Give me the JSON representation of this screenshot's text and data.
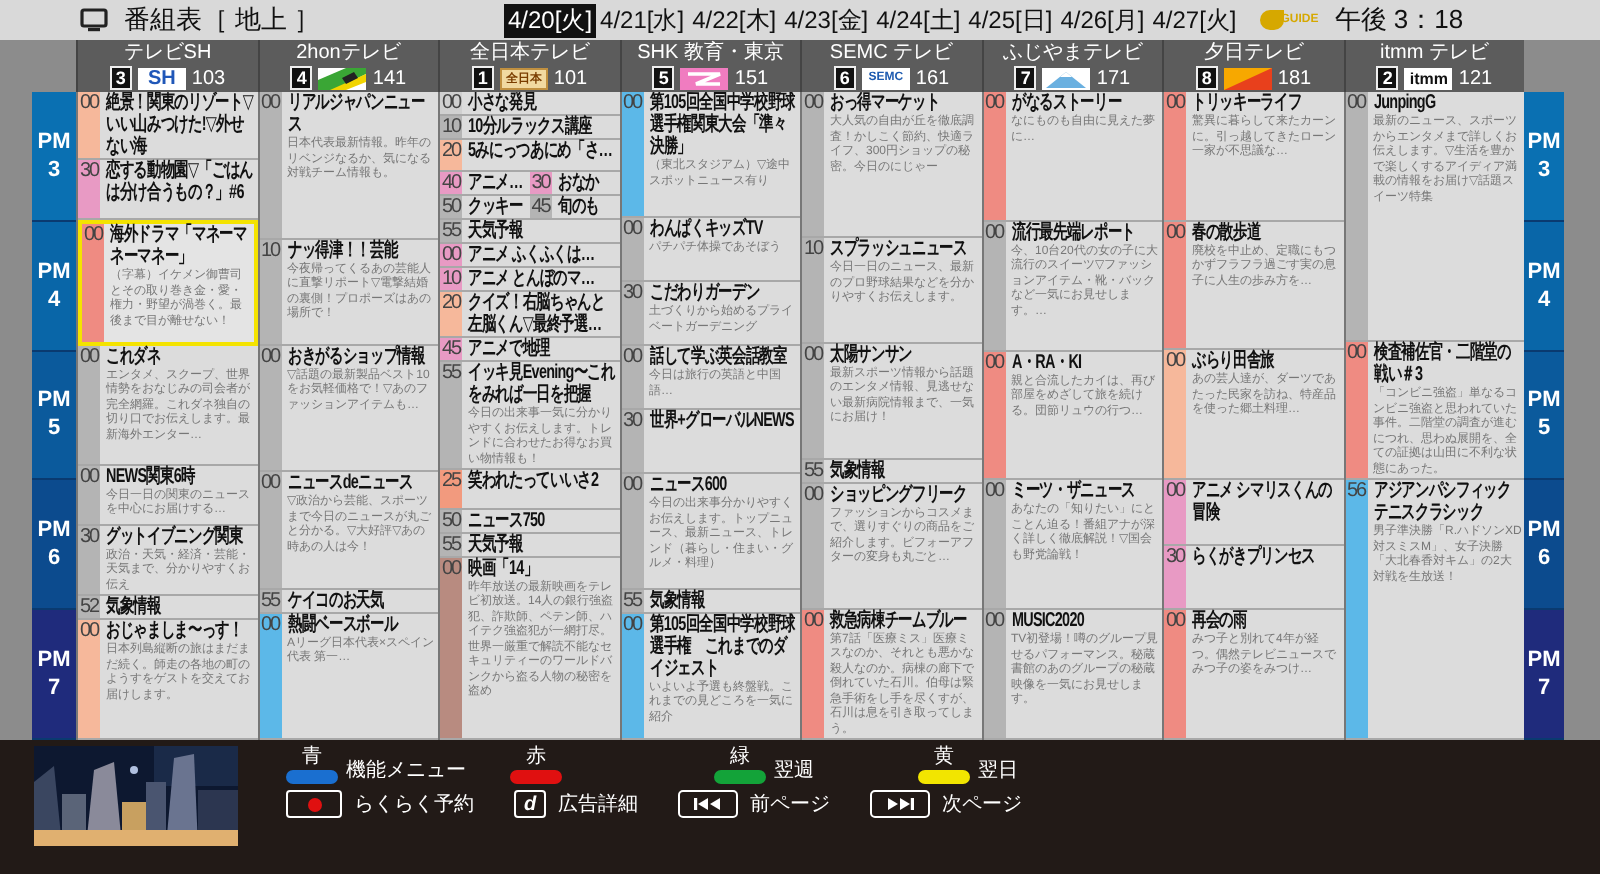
{
  "header": {
    "title": "番組表［ 地上 ］",
    "dates": [
      {
        "label": "4/20[火]",
        "selected": true
      },
      {
        "label": "4/21[水]",
        "selected": false
      },
      {
        "label": "4/22[木]",
        "selected": false
      },
      {
        "label": "4/23[金]",
        "selected": false
      },
      {
        "label": "4/24[土]",
        "selected": false
      },
      {
        "label": "4/25[日]",
        "selected": false
      },
      {
        "label": "4/26[月]",
        "selected": false
      },
      {
        "label": "4/27[火]",
        "selected": false
      }
    ],
    "logo_text": "GUIDE",
    "clock": "午後 3：18"
  },
  "time_left": [
    {
      "label": "PM",
      "hour": "3"
    },
    {
      "label": "PM",
      "hour": "4"
    },
    {
      "label": "PM",
      "hour": "5"
    },
    {
      "label": "PM",
      "hour": "6"
    },
    {
      "label": "PM",
      "hour": "7"
    }
  ],
  "time_right": [
    {
      "label": "PM",
      "hour": "3"
    },
    {
      "label": "PM",
      "hour": "4"
    },
    {
      "label": "PM",
      "hour": "5"
    },
    {
      "label": "PM",
      "hour": "6"
    },
    {
      "label": "PM",
      "hour": "7"
    }
  ],
  "channels": [
    {
      "name": "テレビSH",
      "button": "3",
      "logo": {
        "kind": "sh",
        "text": "SH"
      },
      "number": "103",
      "slots": [
        [
          {
            "kind": "program",
            "minute": "00",
            "title": "絶景！関東のリゾート▽いい山みつけた!▽外せない海",
            "color": "#f6b89b",
            "selected": false
          },
          {
            "kind": "program",
            "minute": "30",
            "title": "恋する動物園▽「ごはんは分け合うもの？」#6",
            "color": "#e89ac4",
            "selected": false
          }
        ],
        [
          {
            "kind": "program",
            "minute": "00",
            "title": "海外ドラマ「マネーマネーマネー」",
            "desc": "（字幕）イケメン御曹司とその取り巻き金・愛・権力・野望が渦巻く。最後まで目が離せない！",
            "color": "#ef8b82",
            "selected": true
          }
        ],
        [
          {
            "kind": "program",
            "minute": "00",
            "title": "これダネ",
            "desc": "エンタメ、スクープ、世界情勢をおなじみの司会者が完全網羅。これダネ独自の切り口でお伝えします。最新海外エンター…",
            "color": "#b4b4b4",
            "selected": false
          }
        ],
        [
          {
            "kind": "program",
            "minute": "00",
            "title": "NEWS関東6時",
            "desc": "今日一日の関東のニュースを中心にお届けする…",
            "color": "#b4b4b4",
            "selected": false
          },
          {
            "kind": "program",
            "minute": "30",
            "title": "グットイブニング関東",
            "desc": "政治・天気・経済・芸能・天気まで、分かりやすくお伝え",
            "color": "#b4b4b4",
            "selected": false
          },
          {
            "kind": "program",
            "minute": "52",
            "title": "気象情報",
            "color": "#b4b4b4",
            "selected": false
          }
        ],
        [
          {
            "kind": "program",
            "minute": "00",
            "title": "おじゃましま〜っす！",
            "desc": "日本列島縦断の旅はまだまだ続く。師走の各地の町のようすをゲストを交えてお届けします。",
            "color": "#f6b89b",
            "selected": false
          }
        ]
      ]
    },
    {
      "name": "2honテレビ",
      "button": "4",
      "logo": {
        "kind": "stripe"
      },
      "number": "141",
      "slots": [
        [
          {
            "kind": "program",
            "minute": "00",
            "title": "リアルジャパンニュース",
            "desc": "日本代表最新情報。昨年のリベンジなるか、気になる対戦チーム情報も。",
            "color": "#b4b4b4",
            "selected": false
          }
        ],
        [
          {
            "kind": "program",
            "minute": "10",
            "title": "ナッ得津！！芸能",
            "desc": "今夜帰ってくるあの芸能人に直撃リポート▽電撃結婚の裏側！プロポーズはあの場所で！",
            "color": "#b4b4b4",
            "selected": false
          }
        ],
        [
          {
            "kind": "program",
            "minute": "00",
            "title": "おきがるショップ情報",
            "desc": "▽話題の最新製品ベスト10をお気軽価格で！▽あのファッションアイテムも…",
            "color": "#b4b4b4",
            "selected": false
          }
        ],
        [
          {
            "kind": "program",
            "minute": "00",
            "title": "ニュースdeニュース",
            "desc": "▽政治から芸能、スポーツまで今日のニュースが丸ごと分かる。▽大好評▽あの時あの人は今！",
            "color": "#b4b4b4",
            "selected": false
          },
          {
            "kind": "program",
            "minute": "55",
            "title": "ケイコのお天気",
            "color": "#b4b4b4",
            "selected": false
          }
        ],
        [
          {
            "kind": "program",
            "minute": "00",
            "title": "熱闘ベースボール",
            "desc": "Aリーグ日本代表×スペイン代表 第一…",
            "color": "#5cb8e8",
            "selected": false
          }
        ]
      ]
    },
    {
      "name": "全日本テレビ",
      "button": "1",
      "logo": {
        "kind": "zennihon",
        "text": "全日本"
      },
      "number": "101",
      "slots": [
        [
          {
            "kind": "program",
            "minute": "00",
            "title": "小さな発見",
            "color": "#d0d0d0",
            "selected": false
          },
          {
            "kind": "program",
            "minute": "10",
            "title": "10分ルラックス講座",
            "color": "#b4b4b4",
            "selected": false
          },
          {
            "kind": "program",
            "minute": "20",
            "title": "5みにっつあにめ「さ…",
            "color": "#f6b89b",
            "selected": false
          },
          {
            "kind": "pair",
            "halves": [
              {
                "minute": "40",
                "title": "アニメ…",
                "color": "#e89ac4",
                "selected": false
              },
              {
                "minute": "30",
                "title": "おなか",
                "color": "#e89ac4",
                "selected": false
              }
            ]
          },
          {
            "kind": "pair",
            "halves": [
              {
                "minute": "50",
                "title": "クッキー",
                "color": "#b4b4b4",
                "selected": false
              },
              {
                "minute": "45",
                "title": "旬のも",
                "color": "#b4b4b4",
                "selected": false
              }
            ]
          },
          {
            "kind": "program",
            "minute": "55",
            "title": "天気予報",
            "color": "#b4b4b4",
            "selected": false
          }
        ],
        [
          {
            "kind": "program",
            "minute": "00",
            "title": "アニメ ふくふくは…",
            "color": "#e89ac4",
            "selected": false
          },
          {
            "kind": "program",
            "minute": "10",
            "title": "アニメ とんぼのマ…",
            "color": "#e89ac4",
            "selected": false
          },
          {
            "kind": "program",
            "minute": "20",
            "title": "クイズ！右脳ちゃんと左脳くん▽最終予選…",
            "color": "#f6b89b",
            "selected": false
          },
          {
            "kind": "program",
            "minute": "45",
            "title": "アニメで地理",
            "color": "#e89ac4",
            "selected": false
          },
          {
            "kind": "program",
            "minute": "55",
            "title": "イッキ見Evening〜これをみれば一日を把握",
            "desc": "今日の出来事一気に分かりやすくお伝えします。トレンドに合わせたお得なお買い物情報も！",
            "color": "#b4b4b4",
            "selected": false
          }
        ],
        [
          {
            "kind": "program",
            "minute": "25",
            "title": "笑われたっていいさ2",
            "color": "#f29a7e",
            "selected": false
          },
          {
            "kind": "program",
            "minute": "50",
            "title": "ニュース750",
            "color": "#b4b4b4",
            "selected": false
          },
          {
            "kind": "program",
            "minute": "55",
            "title": "天気予報",
            "color": "#b4b4b4",
            "selected": false
          }
        ],
        [
          {
            "kind": "program",
            "minute": "00",
            "title": "映画「14」",
            "desc": "昨年放送の最新映画をテレビ初放送。14人の銀行強盗犯、詐欺師、ペテン師、ハイテク強盗犯が一網打尽。世界一厳重で解読不能なセキュリティーのワールドバンクから盗る人物の秘密を盗め",
            "color": "#b88b80",
            "selected": false
          }
        ]
      ]
    },
    {
      "name": "SHK 教育・東京",
      "button": "5",
      "logo": {
        "kind": "shk"
      },
      "number": "151",
      "slots": [
        [
          {
            "kind": "program",
            "minute": "00",
            "title": "第105回全国中学校野球選手権関東大会「準々決勝」",
            "desc": "（東北スタジアム）▽途中スポットニュース有り",
            "color": "#5cb8e8",
            "selected": false
          }
        ],
        [
          {
            "kind": "program",
            "minute": "00",
            "title": "わんぱくキッズTV",
            "desc": "パチパチ体操であそぼう",
            "color": "#b4b4b4",
            "selected": false
          },
          {
            "kind": "program",
            "minute": "30",
            "title": "こだわりガーデン",
            "desc": "土づくりから始めるプライベートガーデニング",
            "color": "#b4b4b4",
            "selected": false
          }
        ],
        [
          {
            "kind": "program",
            "minute": "00",
            "title": "話して学ぶ英会話教室",
            "desc": "今日は旅行の英語と中国語…",
            "color": "#b4b4b4",
            "selected": false
          },
          {
            "kind": "program",
            "minute": "30",
            "title": "世界+グローバルNEWS",
            "color": "#b4b4b4",
            "selected": false
          }
        ],
        [
          {
            "kind": "program",
            "minute": "00",
            "title": "ニュース600",
            "desc": "今日の出来事分かりやすくお伝えします。トップニュース、最新ニュース、トレンド（暮らし・住まい・グルメ・料理）",
            "color": "#b4b4b4",
            "selected": false
          },
          {
            "kind": "program",
            "minute": "55",
            "title": "気象情報",
            "color": "#b4b4b4",
            "selected": false
          }
        ],
        [
          {
            "kind": "program",
            "minute": "00",
            "title": "第105回全国中学校野球選手権　これまでのダイジェスト",
            "desc": "いよいよ予選も終盤戦。これまでの見どころを一気に紹介",
            "color": "#5cb8e8",
            "selected": false
          }
        ]
      ]
    },
    {
      "name": "SEMC テレビ",
      "button": "6",
      "logo": {
        "kind": "semc",
        "text": "SEMC"
      },
      "number": "161",
      "slots": [
        [
          {
            "kind": "program",
            "minute": "00",
            "title": "おっ得マーケット",
            "desc": "大人気の自由が丘を徹底調査！かしこく節約、快適ライフ、300円ショップの秘密。今日のにじゃー",
            "color": "#b4b4b4",
            "selected": false
          }
        ],
        [
          {
            "kind": "program",
            "minute": "10",
            "title": "スプラッシュニュース",
            "desc": "今日一日のニュース、最新のプロ野球結果などを分かりやすくお伝えします。",
            "color": "#b4b4b4",
            "selected": false
          }
        ],
        [
          {
            "kind": "program",
            "minute": "00",
            "title": "太陽サンサン",
            "desc": "最新スポーツ情報から話題のエンタメ情報、見逃せない最新病院情報まで、一気にお届け！",
            "color": "#b4b4b4",
            "selected": false
          },
          {
            "kind": "program",
            "minute": "55",
            "title": "気象情報",
            "color": "#b4b4b4",
            "selected": false
          }
        ],
        [
          {
            "kind": "program",
            "minute": "00",
            "title": "ショッピングフリーク",
            "desc": "ファッションからコスメまで、選りすぐりの商品をご紹介します。ビフォーアフターの変身も丸ごと…",
            "color": "#b4b4b4",
            "selected": false
          }
        ],
        [
          {
            "kind": "program",
            "minute": "00",
            "title": "救急病棟チームブルー",
            "desc": "第7話「医療ミス」医療ミスなのか、それとも悪かな殺人なのか。病棟の廊下で倒れていた石川。伯母は緊急手術をし手を尽くすが、石川は息を引き取ってしまう。",
            "color": "#ef8b82",
            "selected": false
          }
        ]
      ]
    },
    {
      "name": "ふじやまテレビ",
      "button": "7",
      "logo": {
        "kind": "mountain"
      },
      "number": "171",
      "slots": [
        [
          {
            "kind": "program",
            "minute": "00",
            "title": "がなるストーリー",
            "desc": "なにものも自由に見えた夢に…",
            "color": "#ef8b82",
            "selected": false
          }
        ],
        [
          {
            "kind": "program",
            "minute": "00",
            "title": "流行最先端レポート",
            "desc": "今、10台20代の女の子に大流行のスイーツ▽ファッションアイテム・靴・バックなど一気にお見せします。…",
            "color": "#b4b4b4",
            "selected": false
          }
        ],
        [
          {
            "kind": "program",
            "minute": "00",
            "title": "A・RA・KI",
            "desc": "親と合流したカイは、再び部屋をめざして旅を続ける。団節リュウの行つ…",
            "color": "#ef8b82",
            "selected": false
          }
        ],
        [
          {
            "kind": "program",
            "minute": "00",
            "title": "ミーツ・ザニュース",
            "desc": "あなたの「知りたい」にとことん迫る！番組アナが深く詳しく徹底解説！▽国会も野党論戦！",
            "color": "#b4b4b4",
            "selected": false
          }
        ],
        [
          {
            "kind": "program",
            "minute": "00",
            "title": "MUSIC2020",
            "desc": "TV初登場！噂のグループ見せるパフォーマンス。秘蔵書館のあのグループの秘蔵映像を一気にお見せします。",
            "color": "#b4b4b4",
            "selected": false
          }
        ]
      ]
    },
    {
      "name": "夕日テレビ",
      "button": "8",
      "logo": {
        "kind": "sunset"
      },
      "number": "181",
      "slots": [
        [
          {
            "kind": "program",
            "minute": "00",
            "title": "トリッキーライフ",
            "desc": "驚異に暮らして来たカーンに。引っ越してきたローン一家が不思議な…",
            "color": "#ef8b82",
            "selected": false
          }
        ],
        [
          {
            "kind": "program",
            "minute": "00",
            "title": "春の散歩道",
            "desc": "廃校を中止め、定職にもつかずフラフラ過ごす実の息子に人生の歩み方を…",
            "color": "#ef8b82",
            "selected": false
          }
        ],
        [
          {
            "kind": "program",
            "minute": "00",
            "title": "ぶらり田舎旅",
            "desc": "あの芸人達が、ダーツであたった民家を訪ね、特産品を使った郷土料理…",
            "color": "#f6b89b",
            "selected": false
          }
        ],
        [
          {
            "kind": "program",
            "minute": "00",
            "title": "アニメ シマリスくんの冒険",
            "color": "#e89ac4",
            "selected": false
          },
          {
            "kind": "program",
            "minute": "30",
            "title": "らくがきプリンセス",
            "color": "#e89ac4",
            "selected": false
          }
        ],
        [
          {
            "kind": "program",
            "minute": "00",
            "title": "再会の雨",
            "desc": "みつ子と別れて4年が経つ。偶然テレビニュースでみつ子の姿をみつけ…",
            "color": "#ef8b82",
            "selected": false
          }
        ]
      ]
    },
    {
      "name": "itmm テレビ",
      "button": "2",
      "logo": {
        "kind": "itmm",
        "text": "itmm"
      },
      "number": "121",
      "slots": [
        [
          {
            "kind": "program",
            "minute": "00",
            "title": "JunpingG",
            "desc": "最新のニュース、スポーツからエンタメまで詳しくお伝えします。▽生活を豊かで楽しくするアイディア満載の情報をお届け▽話題スイーツ特集",
            "color": "#b4b4b4",
            "selected": false
          }
        ],
        {
          "continued": true
        },
        [
          {
            "kind": "program",
            "minute": "00",
            "title": "検査補佐官・二階堂の戦い＃3",
            "desc": "「コンビニ強盗」単なるコンビニ強盗と思われていた事件。二階堂の調査が進むにつれ、思わぬ展開を、全ての証拠は山田に不利な状態にあった。",
            "color": "#ef8b82",
            "selected": false
          },
          {
            "kind": "program",
            "minute": "56",
            "title": "アジアンパシフィックテニスクラシック",
            "desc": "男子準決勝「R.ハドソンXD対スミスM」、女子決勝「大北春香対キム」の2大対戦を生放送！",
            "color": "#5cb8e8",
            "selected": false
          }
        ]
      ]
    }
  ],
  "color_keys": [
    {
      "key": "青",
      "color": "#1a6fd0",
      "text": "機能メニュー"
    },
    {
      "key": "赤",
      "color": "#e01010"
    },
    {
      "key": "緑",
      "color": "#13a339",
      "text": "翌週"
    },
    {
      "key": "黄",
      "color": "#f2e500",
      "text": "翌日"
    }
  ],
  "buttons": [
    {
      "kind": "record",
      "text": "らくらく予約"
    },
    {
      "kind": "d",
      "glyph": "d",
      "text": "広告詳細"
    },
    {
      "kind": "prev",
      "text": "前ページ"
    },
    {
      "kind": "next",
      "text": "次ページ"
    }
  ]
}
